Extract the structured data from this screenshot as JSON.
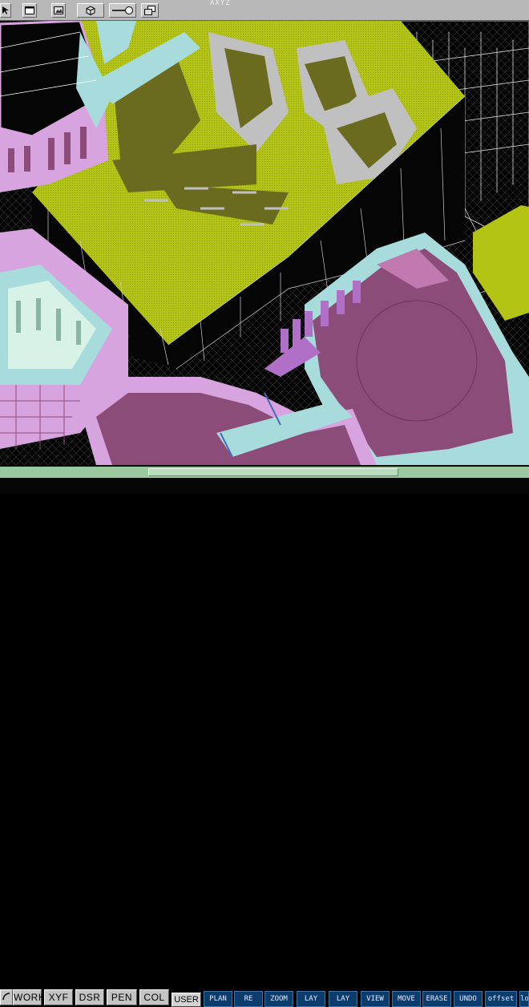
{
  "window": {
    "title_fragment": "AXYZ"
  },
  "toolbar": {
    "buttons": [
      {
        "icon": "cursor-icon"
      },
      {
        "icon": "window-icon"
      },
      {
        "icon": "image-icon"
      },
      {
        "icon": "cube-icon"
      },
      {
        "icon": "slider-line-icon"
      },
      {
        "icon": "stack-windows-icon"
      }
    ]
  },
  "mode_tabs": [
    "WORK",
    "XYF",
    "DSR",
    "PEN",
    "COL"
  ],
  "user_label": "USER",
  "commands": [
    "PLAN",
    "RE",
    "ZOOM",
    "LAY",
    "LAY",
    "VIEW",
    "MOVE",
    "ERASE",
    "UNDO",
    "offset",
    "lo"
  ],
  "colors": {
    "toolbar": "#b8b8b8",
    "command_blue": "#0c3c6c",
    "scrollbar_green": "#9cc8a0",
    "plaza_yellow_green": "#b4c414",
    "roof_purple": "#8c4c7a",
    "glass_cyan": "#a8dcdc",
    "lilac": "#d8a4e0"
  }
}
